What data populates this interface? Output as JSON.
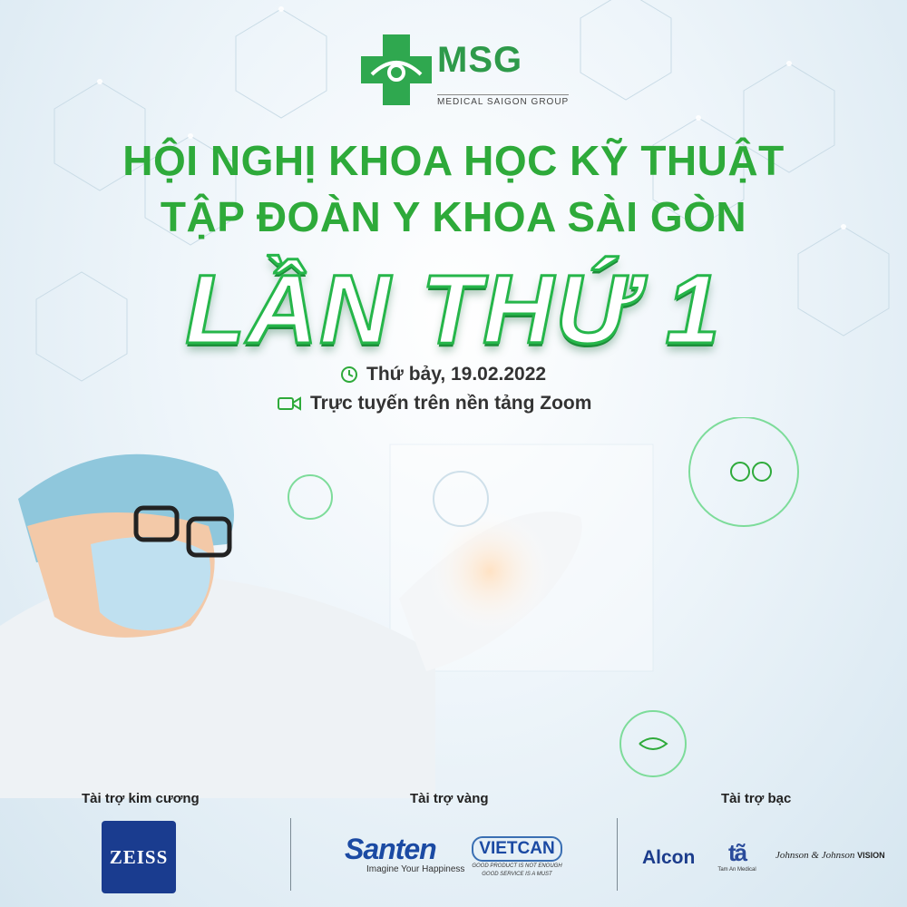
{
  "logo": {
    "name": "MSG",
    "sub": "MEDICAL SAIGON GROUP"
  },
  "headline": {
    "line1": "HỘI NGHỊ KHOA HỌC KỸ THUẬT",
    "line2": "TẬP ĐOÀN Y KHOA SÀI GÒN",
    "edition": "LẦN THỨ 1"
  },
  "info": {
    "date": "Thứ bảy, 19.02.2022",
    "platform": "Trực tuyến trên nền tảng Zoom"
  },
  "sponsors": {
    "diamond_label": "Tài trợ kim cương",
    "gold_label": "Tài trợ vàng",
    "silver_label": "Tài trợ bạc",
    "zeiss": "ZEISS",
    "santen": "Santen",
    "santen_tag": "Imagine Your Happiness",
    "vietcan": "VIETCAN",
    "vietcan_tag1": "GOOD PRODUCT IS NOT ENOUGH",
    "vietcan_tag2": "GOOD SERVICE IS A MUST",
    "alcon": "Alcon",
    "taman_mark": "tã",
    "taman": "Tam An Medical",
    "jj": "Johnson & Johnson",
    "jj_vision": "VISION"
  },
  "colors": {
    "brand_green": "#2eaa3a",
    "navy": "#1b4aa3"
  }
}
